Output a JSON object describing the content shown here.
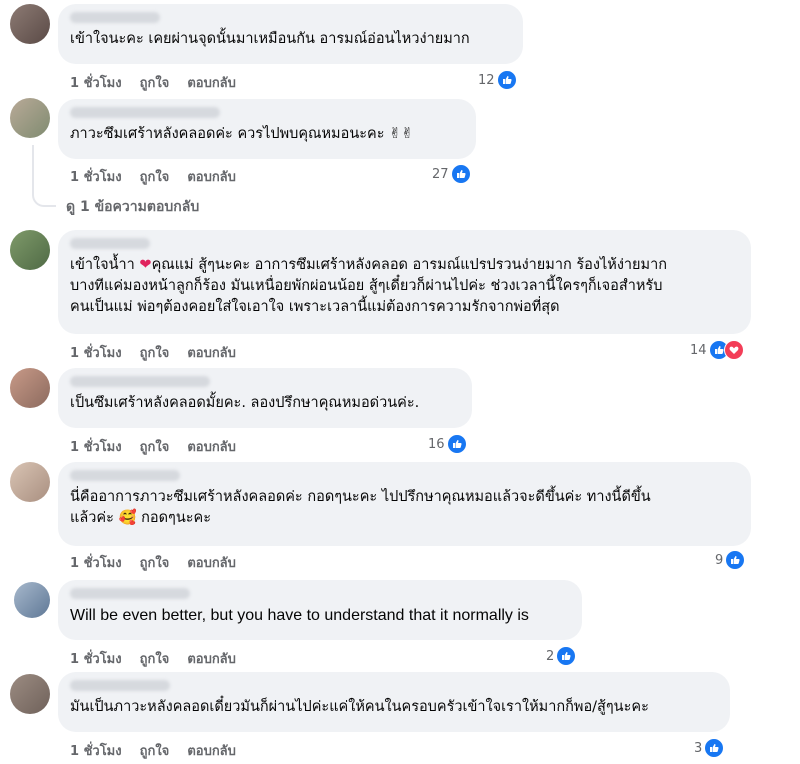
{
  "comments": [
    {
      "text": "เข้าใจนะคะ เคยผ่านจุดนั้นมาเหมือนกัน อารมณ์อ่อนไหวง่ายมาก",
      "time": "1 ชั่วโมง",
      "like": "ถูกใจ",
      "reply": "ตอบกลับ",
      "count": "12"
    },
    {
      "text": "ภาวะซึมเศร้าหลังคลอดค่ะ ควรไปพบคุณหมอนะคะ ✌✌",
      "time": "1 ชั่วโมง",
      "like": "ถูกใจ",
      "reply": "ตอบกลับ",
      "count": "27"
    },
    {
      "text_a": "เข้าใจน้ำา ",
      "text_b": "คุณแม่ สู้ๆนะคะ อาการซึมเศร้าหลังคลอด อารมณ์แปรปรวนง่ายมาก ร้องไห้ง่ายมาก\nบางทีแค่มองหน้าลูกก็ร้อง มันเหนื่อยพักผ่อนน้อย สู้ๆเดี๋ยวก็ผ่านไปค่ะ ช่วงเวลานี้ใครๆก็เจอสำหรับ\nคนเป็นแม่ พ่อๆต้องคอยใส่ใจเอาใจ เพราะเวลานี้แม่ต้องการความรักจากพ่อที่สุด",
      "time": "1 ชั่วโมง",
      "like": "ถูกใจ",
      "reply": "ตอบกลับ",
      "count": "14"
    },
    {
      "text": "เป็นซึมเศร้าหลังคลอดมั้ยคะ. ลองปรึกษาคุณหมอด่วนค่ะ.",
      "time": "1 ชั่วโมง",
      "like": "ถูกใจ",
      "reply": "ตอบกลับ",
      "count": "16"
    },
    {
      "text_a": "นี่คืออาการภาวะซึมเศร้าหลังคลอดค่ะ กอดๆนะคะ ไปปรึกษาคุณหมอแล้วจะดีขึ้นค่ะ ทางนี้ดีขึ้น\nแล้วค่ะ ",
      "emoji": "🥰",
      "text_b": " กอดๆนะคะ",
      "time": "1 ชั่วโมง",
      "like": "ถูกใจ",
      "reply": "ตอบกลับ",
      "count": "9"
    },
    {
      "text": "Will be even better, but you have to understand that it normally is",
      "time": "1 ชั่วโมง",
      "like": "ถูกใจ",
      "reply": "ตอบกลับ",
      "count": "2"
    },
    {
      "text": "มันเป็นภาวะหลังคลอดเดี๋ยวมันก็ผ่านไปค่ะแค่ให้คนในครอบครัวเข้าใจเราให้มากก็พอ/สู้ๆนะคะ",
      "time": "1 ชั่วโมง",
      "like": "ถูกใจ",
      "reply": "ตอบกลับ",
      "count": "3"
    }
  ],
  "view_replies": "ดู 1 ข้อความตอบกลับ",
  "colors": {
    "bubble": "#f0f2f5",
    "like_blue": "#1877f2",
    "heart_red": "#f33e58",
    "meta_gray": "#65676b"
  },
  "icons": {
    "like": "thumbs-up-icon",
    "heart": "heart-icon"
  }
}
